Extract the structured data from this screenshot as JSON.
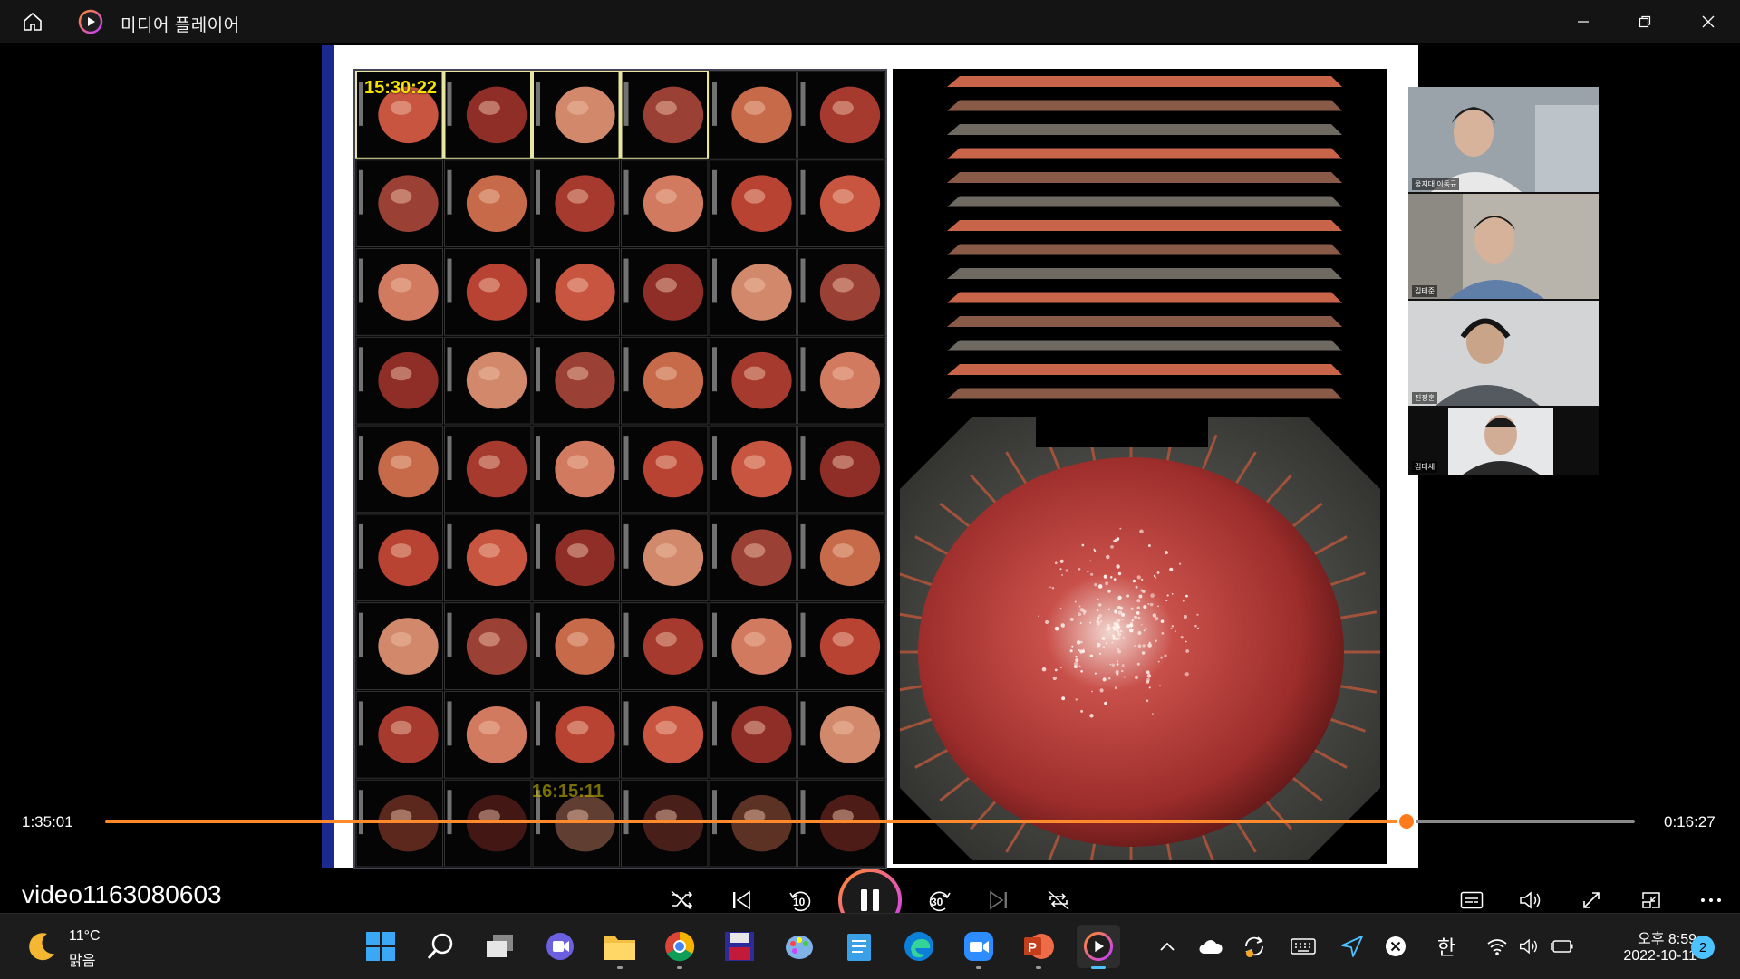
{
  "window": {
    "title": "미디어 플레이어",
    "icons": {
      "home": "home-icon",
      "app": "media-player-icon",
      "minimize": "minimize-icon",
      "maximize": "restore-icon",
      "close": "close-icon"
    }
  },
  "video": {
    "slide": {
      "timestamp_top": "15:30:22",
      "timestamp_bottom": "16:15:11"
    },
    "participants": [
      {
        "name": "울지대 이동규"
      },
      {
        "name": "김태준"
      },
      {
        "name": "진정훈"
      },
      {
        "name": "김태세"
      }
    ]
  },
  "player": {
    "current_time": "1:35:01",
    "remaining_time": "0:16:27",
    "progress_fraction": 0.851,
    "accent_color": "#ff8a2b",
    "video_name": "video1163080603",
    "buttons": {
      "shuffle": "shuffle-icon",
      "previous": "previous-icon",
      "rewind_10": "10",
      "play_pause": "pause-icon",
      "forward_30": "30",
      "next": "next-icon",
      "repeat": "repeat-off-icon",
      "subtitles": "subtitles-icon",
      "volume": "volume-icon",
      "fullscreen": "fullscreen-icon",
      "mini_player": "mini-player-icon",
      "more": "more-icon"
    }
  },
  "taskbar": {
    "weather": {
      "temp": "11°C",
      "desc": "맑음",
      "icon": "moon-icon"
    },
    "apps": [
      "start-icon",
      "search-icon",
      "task-view-icon",
      "chat-icon",
      "file-explorer-icon",
      "chrome-icon",
      "save-app-icon",
      "paint-icon",
      "notepad-icon",
      "edge-icon",
      "zoom-icon",
      "powerpoint-icon",
      "media-player-icon"
    ],
    "tray": {
      "ime": "한",
      "time": "오후 8:59",
      "date": "2022-10-11",
      "notifications": "2"
    }
  }
}
